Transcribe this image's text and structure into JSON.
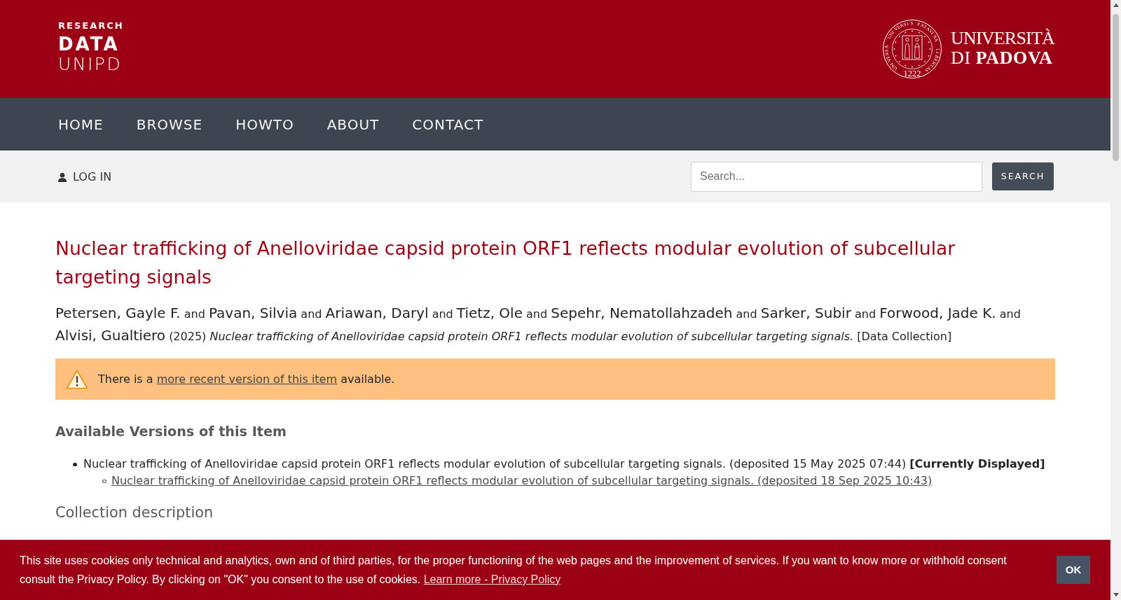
{
  "header": {
    "logo": {
      "lines": [
        "RESEARCH",
        "DATA",
        "UNIPD"
      ]
    },
    "university_logo": {
      "seal_motto": {
        "top": "UNIVERSIS PATAVINA",
        "left": "UNIVERSA",
        "right": "LIBERTAS"
      },
      "seal_year": "1222",
      "lines": [
        "UNIVERSITÀ",
        "DI **PADOVA**"
      ]
    }
  },
  "nav": {
    "items": [
      {
        "label": "HOME"
      },
      {
        "label": "BROWSE"
      },
      {
        "label": "HOWTO"
      },
      {
        "label": "ABOUT"
      },
      {
        "label": "CONTACT"
      }
    ]
  },
  "toolbar": {
    "login": "LOG IN",
    "search": {
      "placeholder": "Search..."
    },
    "search_button": "SEARCH"
  },
  "item": {
    "title": "Nuclear trafficking of Anelloviridae capsid protein ORF1 reflects modular evolution of subcellular targeting signals",
    "citation": [
      {
        "kind": "name",
        "text": "Petersen, Gayle F."
      },
      {
        "kind": "conjunction",
        "text": "and"
      },
      {
        "kind": "name",
        "text": "Pavan, Silvia"
      },
      {
        "kind": "conjunction",
        "text": "and"
      },
      {
        "kind": "name",
        "text": "Ariawan, Daryl"
      },
      {
        "kind": "conjunction",
        "text": "and"
      },
      {
        "kind": "name",
        "text": "Tietz, Ole"
      },
      {
        "kind": "conjunction",
        "text": "and"
      },
      {
        "kind": "name",
        "text": "Sepehr, Nematollahzadeh"
      },
      {
        "kind": "conjunction",
        "text": "and"
      },
      {
        "kind": "name",
        "text": "Sarker, Subir"
      },
      {
        "kind": "conjunction",
        "text": "and"
      },
      {
        "kind": "name",
        "text": "Forwood, Jade K."
      },
      {
        "kind": "conjunction",
        "text": "and"
      },
      {
        "kind": "name",
        "text": "Alvisi, Gualtiero"
      },
      {
        "kind": "year",
        "text": "(2025)"
      },
      {
        "kind": "title",
        "text": "Nuclear trafficking of Anelloviridae capsid protein ORF1 reflects modular evolution of subcellular targeting signals."
      },
      {
        "kind": "type",
        "text": "[Data Collection]"
      }
    ],
    "notice": {
      "before": "There is a",
      "link": "more recent version of this item",
      "after": "available."
    },
    "versions": {
      "heading": "Available Versions of this Item",
      "items": [
        {
          "kind": "text",
          "text": "Nuclear trafficking of Anelloviridae capsid protein ORF1 reflects modular evolution of subcellular targeting signals. (deposited 15 May 2025 07:44) **[Currently Displayed]**",
          "children": [
            {
              "kind": "link",
              "text": "Nuclear trafficking of Anelloviridae capsid protein ORF1 reflects modular evolution of subcellular targeting signals. (deposited 18 Sep 2025 10:43)"
            }
          ]
        }
      ]
    },
    "description_heading": "Collection description"
  },
  "cookie_banner": {
    "text": "This site uses cookies only technical and analytics, own and of third parties, for the proper functioning of the web pages and the improvement of services. If you want to know more or withhold consent consult the Privacy Policy. By clicking on \"OK\" you consent to the use of cookies.",
    "link": "Learn more - Privacy Policy",
    "button": "OK"
  }
}
